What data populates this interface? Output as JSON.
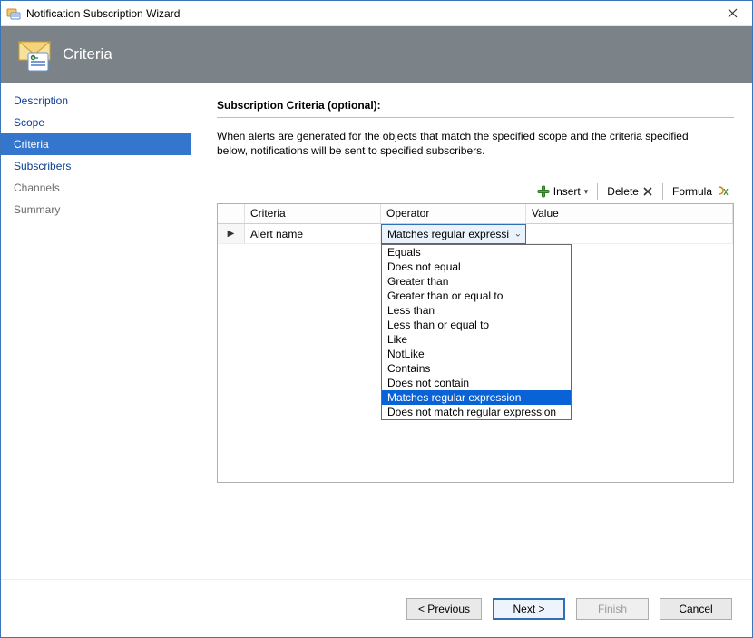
{
  "window": {
    "title": "Notification Subscription Wizard"
  },
  "banner": {
    "title": "Criteria"
  },
  "sidebar": {
    "items": [
      {
        "label": "Description",
        "active": false,
        "muted": false
      },
      {
        "label": "Scope",
        "active": false,
        "muted": false
      },
      {
        "label": "Criteria",
        "active": true,
        "muted": false
      },
      {
        "label": "Subscribers",
        "active": false,
        "muted": false
      },
      {
        "label": "Channels",
        "active": false,
        "muted": true
      },
      {
        "label": "Summary",
        "active": false,
        "muted": true
      }
    ]
  },
  "section": {
    "title": "Subscription Criteria (optional):",
    "description": "When alerts are generated for the objects that match the specified scope and the criteria specified below, notifications will be sent to specified subscribers."
  },
  "toolbar": {
    "insert_label": "Insert",
    "delete_label": "Delete",
    "formula_label": "Formula"
  },
  "grid": {
    "headers": {
      "criteria": "Criteria",
      "operator": "Operator",
      "value": "Value"
    },
    "row_marker": "▶",
    "rows": [
      {
        "criteria": "Alert name",
        "operator_display": "Matches regular expression",
        "value": ""
      }
    ]
  },
  "operator_dropdown": {
    "options": [
      "Equals",
      "Does not equal",
      "Greater than",
      "Greater than or equal to",
      "Less than",
      "Less than or equal to",
      "Like",
      "NotLike",
      "Contains",
      "Does not contain",
      "Matches regular expression",
      "Does not match regular expression"
    ],
    "selected_index": 10
  },
  "footer": {
    "previous": "< Previous",
    "next": "Next >",
    "finish": "Finish",
    "cancel": "Cancel"
  }
}
